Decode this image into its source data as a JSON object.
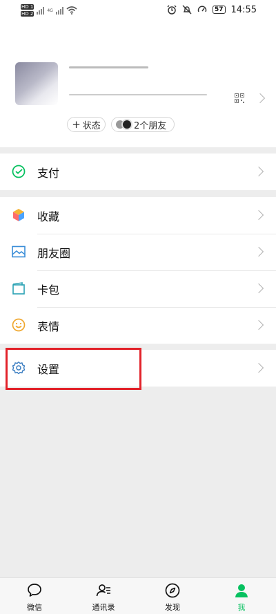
{
  "status_bar": {
    "sim1": "HD 1",
    "sim2": "HD 2",
    "net1": "4G",
    "battery": "57",
    "time": "14:55"
  },
  "profile": {
    "status_button": "状态",
    "friends_button": "2个朋友"
  },
  "menu": {
    "pay": "支付",
    "favorites": "收藏",
    "moments": "朋友圈",
    "cards": "卡包",
    "stickers": "表情",
    "settings": "设置"
  },
  "tabs": [
    {
      "label": "微信",
      "icon": "chat-bubble-icon"
    },
    {
      "label": "通讯录",
      "icon": "contacts-icon"
    },
    {
      "label": "发现",
      "icon": "compass-icon"
    },
    {
      "label": "我",
      "icon": "person-icon"
    }
  ],
  "colors": {
    "accent": "#07c160",
    "highlight": "#e2222a"
  }
}
